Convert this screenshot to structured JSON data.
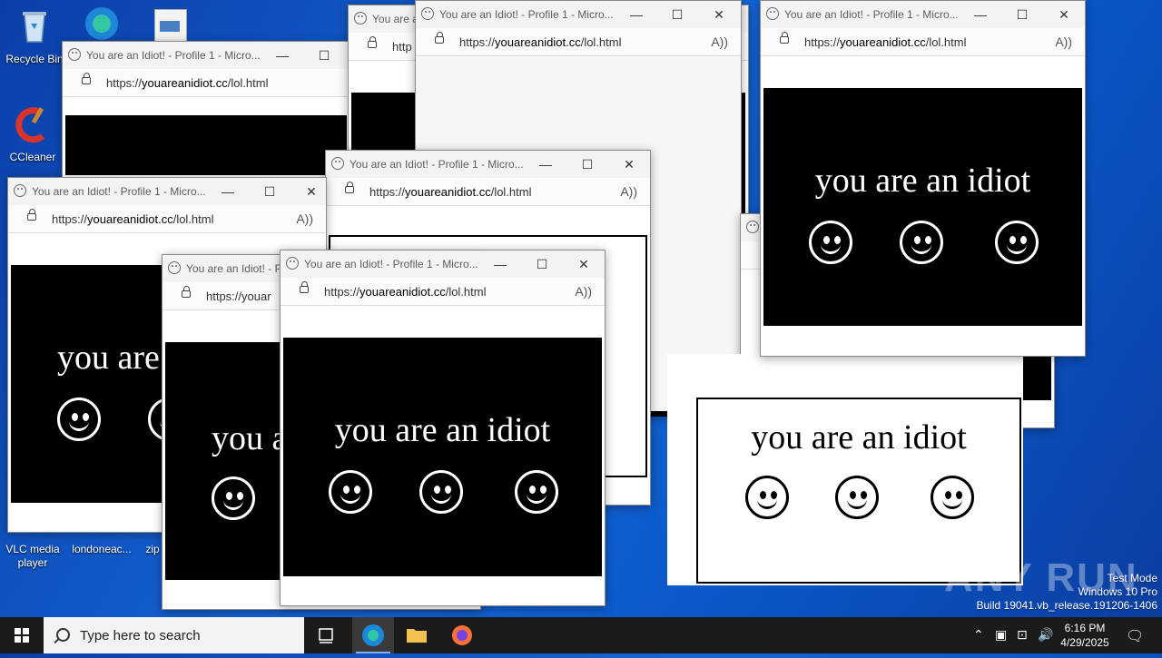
{
  "desktop": {
    "icons": [
      {
        "label": "Recycle Bin"
      },
      {
        "label": "CCleaner"
      },
      {
        "label": "VLC media player"
      },
      {
        "label": "londoneac..."
      },
      {
        "label": "zip"
      }
    ],
    "watermark": {
      "line1": "Test Mode",
      "line2": "Windows 10 Pro",
      "line3": "Build 19041.vb_release.191206-1406"
    },
    "anyrun": "ANY RUN"
  },
  "window": {
    "title": "You are an Idiot! - Profile 1 - Micro...",
    "title_short": "You are an Idiot! - P",
    "title_tiny": "You are a",
    "url_prefix": "https://",
    "url_domain": "youareanidiot.cc",
    "url_path": "/lol.html",
    "url_partial": "https://youar",
    "url_partial2": "http",
    "page_text": "you are an idiot",
    "page_text_short": "you are",
    "page_text_tiny": "you a",
    "min_label": "—",
    "max_label": "☐",
    "close_label": "✕",
    "read_aloud_label": "A))"
  },
  "taskbar": {
    "search_placeholder": "Type here to search",
    "time": "6:16 PM",
    "date": "4/29/2025"
  }
}
